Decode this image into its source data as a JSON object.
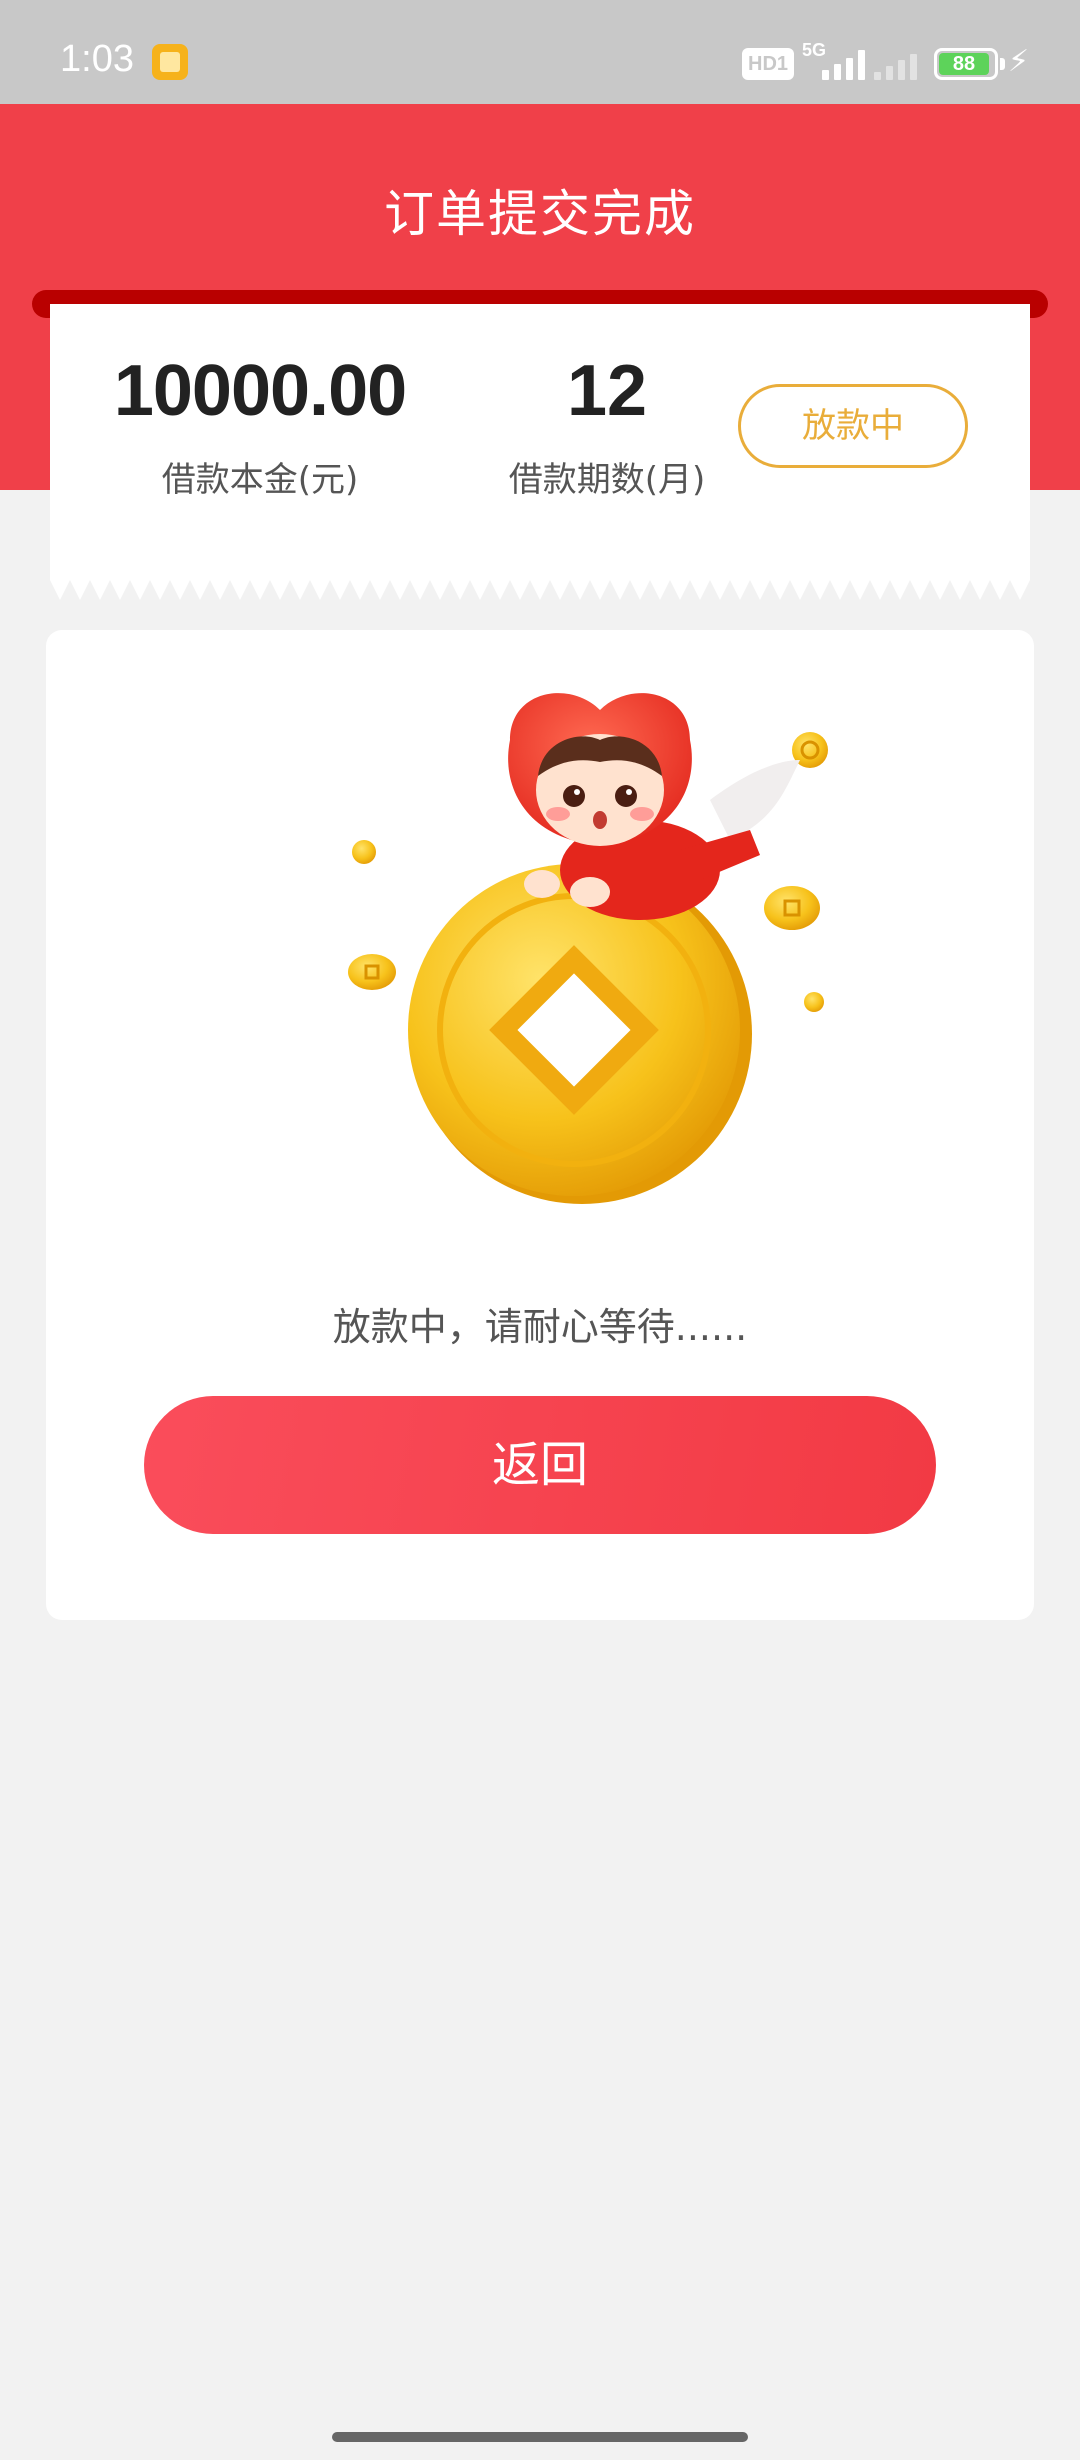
{
  "status_bar": {
    "time": "1:03",
    "hd_label": "HD1",
    "network_label": "5G",
    "battery_level": "88",
    "icons": [
      "app-notification-icon",
      "hd-icon",
      "signal-icon",
      "battery-icon",
      "charging-icon"
    ]
  },
  "header": {
    "title": "订单提交完成",
    "background_color": "#f04049"
  },
  "loan_summary": {
    "amount_value": "10000.00",
    "amount_label": "借款本金(元)",
    "term_value": "12",
    "term_label": "借款期数(月)",
    "status_label": "放款中",
    "status_color": "#e9ad3a"
  },
  "result_card": {
    "illustration_icon": "mascot-on-gold-coin-illustration",
    "message": "放款中，请耐心等待......",
    "back_button_label": "返回",
    "button_color": "#f23a44"
  }
}
